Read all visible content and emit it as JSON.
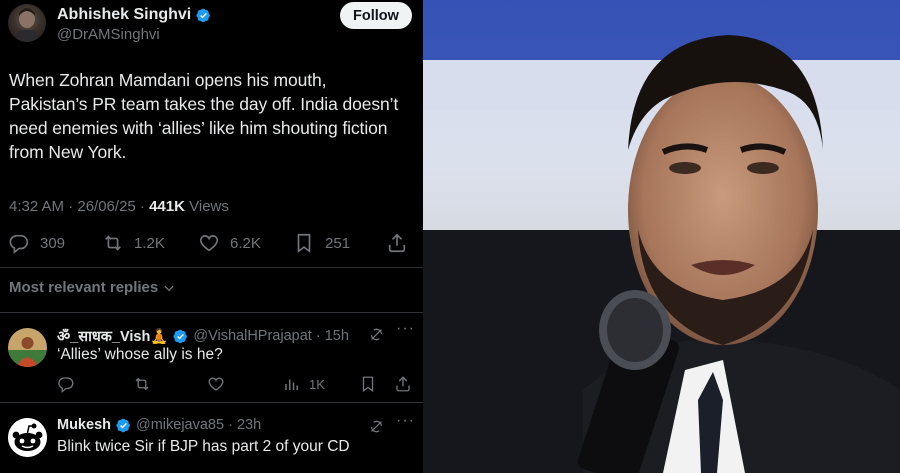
{
  "tweet": {
    "author_name": "Abhishek Singhvi",
    "author_handle": "@DrAMSinghvi",
    "follow_label": "Follow",
    "text": "When Zohran Mamdani opens his mouth, Pakistan’s PR team takes the day off. India doesn’t need enemies with ‘allies’ like him shouting fiction from New York.",
    "time": "4:32 AM · 26/06/25 ·",
    "views_count": "441K",
    "views_label": "Views",
    "replies": "309",
    "reposts": "1.2K",
    "likes": "6.2K",
    "bookmarks": "251"
  },
  "replies_section": {
    "sort_label": "Most relevant replies"
  },
  "replies": [
    {
      "name": "ॐ_साधक_Vish🧘",
      "handle": "@VishalHPrajapat · 15h",
      "text": "‘Allies’ whose ally is he?",
      "views": "1K"
    },
    {
      "name": "Mukesh",
      "handle": "@mikejava85 · 23h",
      "text": "Blink twice Sir if BJP has part 2 of your CD"
    }
  ],
  "colors": {
    "verified": "#1d9bf0",
    "background": "#000000",
    "text": "#e7e9ea",
    "muted": "#71767b"
  },
  "icons": [
    "verified-badge-icon",
    "reply-icon",
    "repost-icon",
    "like-icon",
    "bookmark-icon",
    "share-icon",
    "views-icon",
    "grok-icon",
    "more-icon",
    "chevron-down-icon"
  ]
}
